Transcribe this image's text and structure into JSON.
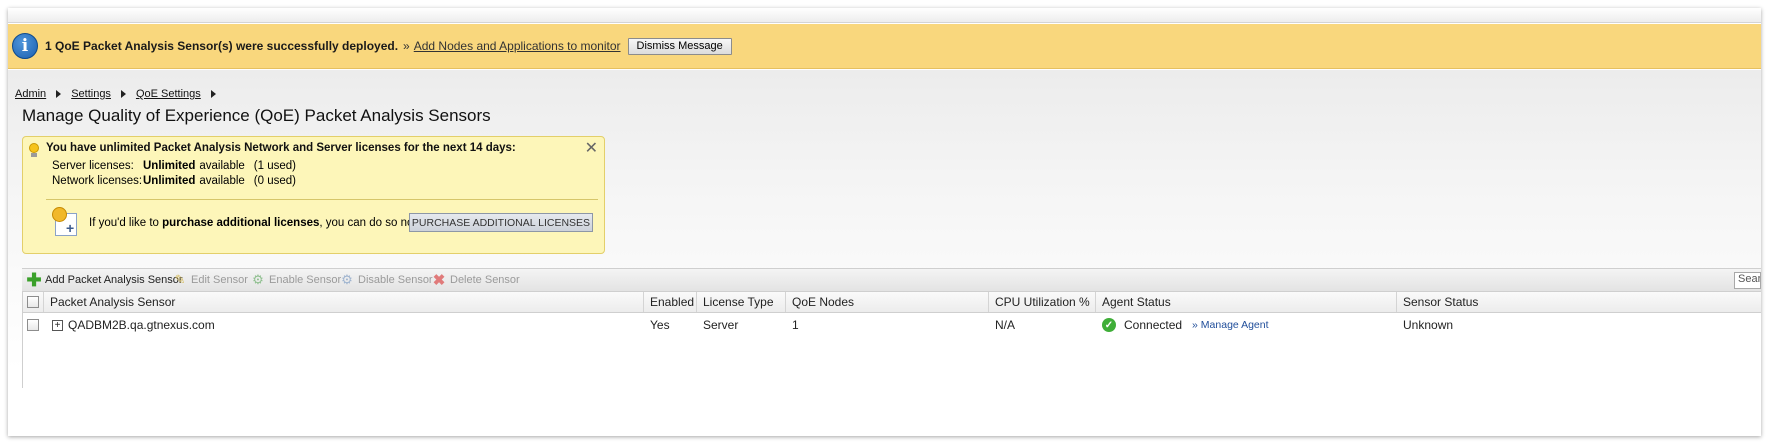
{
  "banner": {
    "message": "1 QoE Packet Analysis Sensor(s) were successfully deployed.",
    "raquo": "»",
    "link_label": "Add Nodes and Applications to monitor",
    "dismiss_label": "Dismiss Message",
    "icon": "info-icon",
    "color": "#f9d77d"
  },
  "breadcrumb": [
    "Admin",
    "Settings",
    "QoE Settings"
  ],
  "page_title": "Manage Quality of Experience (QoE) Packet Analysis Sensors",
  "license_notice": {
    "heading": "You have unlimited Packet Analysis Network and Server licenses for the next 14 days:",
    "close_glyph": "✕",
    "server": {
      "label": "Server licenses:",
      "value": "Unlimited",
      "available": "available",
      "used": "(1 used)"
    },
    "network": {
      "label": "Network licenses:",
      "value": "Unlimited",
      "available": "available",
      "used": "(0 used)"
    },
    "purchase_prefix": "If you'd like to ",
    "purchase_bold": "purchase additional licenses",
    "purchase_suffix": ", you can do so now.",
    "purchase_button": "PURCHASE ADDITIONAL LICENSES"
  },
  "toolbar": {
    "add": "Add Packet Analysis Sensor",
    "edit": "Edit Sensor",
    "enable": "Enable Sensor",
    "disable": "Disable Sensor",
    "delete": "Delete Sensor",
    "search_placeholder": "Search"
  },
  "grid": {
    "columns": [
      "Packet Analysis Sensor",
      "Enabled",
      "License Type",
      "QoE Nodes",
      "CPU Utilization %",
      "Agent Status",
      "Sensor Status"
    ],
    "rows": [
      {
        "sensor": "QADBM2B.qa.gtnexus.com",
        "enabled": "Yes",
        "license_type": "Server",
        "qoe_nodes": "1",
        "cpu": "N/A",
        "agent_status": "Connected",
        "manage_link": "» Manage Agent",
        "sensor_status": "Unknown"
      }
    ]
  }
}
